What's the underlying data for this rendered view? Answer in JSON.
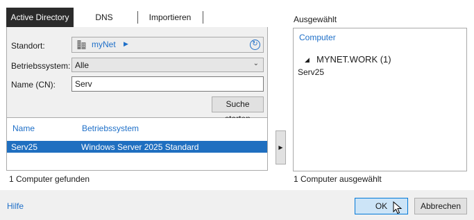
{
  "tabs": [
    {
      "label": "Active Directory",
      "active": true
    },
    {
      "label": "DNS",
      "active": false
    },
    {
      "label": "Importieren",
      "active": false
    }
  ],
  "search": {
    "site_label": "Standort:",
    "site_value": "myNet",
    "os_label": "Betriebssystem:",
    "os_value": "Alle",
    "name_label": "Name (CN):",
    "name_value": "Serv",
    "search_button": "Suche starten"
  },
  "results": {
    "columns": [
      "Name",
      "Betriebssystem"
    ],
    "rows": [
      {
        "name": "Serv25",
        "os": "Windows Server 2025 Standard",
        "selected": true
      }
    ],
    "status": "1 Computer gefunden"
  },
  "selected": {
    "title": "Ausgewählt",
    "header": "Computer",
    "domain": "MYNET.WORK (1)",
    "items": [
      "Serv25"
    ],
    "status": "1 Computer ausgewählt"
  },
  "footer": {
    "help": "Hilfe",
    "ok": "OK",
    "cancel": "Abbrechen"
  },
  "colors": {
    "accent": "#1e6fc8",
    "selection": "#1f6fc0",
    "active_tab": "#2b2b2b",
    "ok_button": "#cce4f7"
  },
  "icons": {
    "site": "building-icon",
    "refresh": "refresh-icon",
    "add": "arrow-right-icon"
  }
}
